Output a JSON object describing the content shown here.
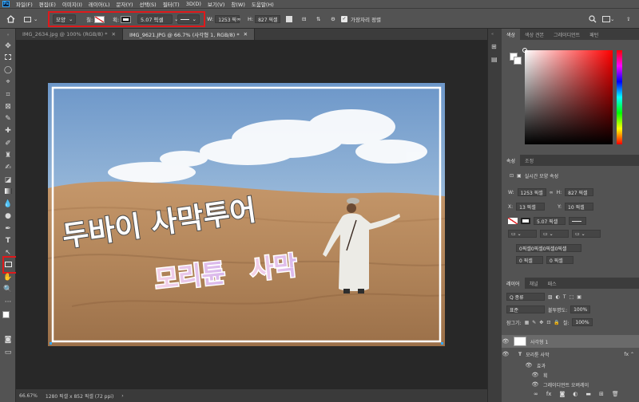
{
  "menu": [
    "파일(F)",
    "편집(E)",
    "이미지(I)",
    "레이어(L)",
    "문자(Y)",
    "선택(S)",
    "필터(T)",
    "3D(D)",
    "보기(V)",
    "창(W)",
    "도움말(H)"
  ],
  "options": {
    "mode": "모양",
    "fill_label": "칠:",
    "stroke_label": "획:",
    "stroke_width": "5.07 픽셀",
    "w_label": "W:",
    "w_value": "1253 픽",
    "h_label": "H:",
    "h_value": "827 픽셀",
    "align_edges": "가장자리 정렬"
  },
  "tabs": [
    "IMG_2634.jpg @ 100% (RGB/8) *",
    "IMG_9621.JPG @ 66.7% (사각형 1, RGB/8) *"
  ],
  "photo_text": {
    "line1": "두바이 사막투어",
    "line2_a": "모리튠",
    "line2_b": "사막"
  },
  "status": {
    "zoom": "66.67%",
    "size": "1280 픽셀 x 852 픽셀 (72 ppi)"
  },
  "color_panel": {
    "tabs": [
      "색상",
      "색상 견본",
      "그레이디언트",
      "패턴"
    ]
  },
  "props_panel": {
    "tabs": [
      "속성",
      "조정"
    ],
    "live_shape": "실시간 모양 속성",
    "w": "1253 픽셀",
    "h": "827 픽셀",
    "x": "13 픽셀",
    "y": "10 픽셀",
    "stroke": "5.07 픽셀",
    "corner_all": "0픽셀0픽셀0픽셀0픽셀",
    "c1": "0 픽셀",
    "c2": "0 픽셀",
    "c3": "0 픽셀",
    "c4": "0 픽셀"
  },
  "layers_panel": {
    "tabs": [
      "레이어",
      "채널",
      "패스"
    ],
    "kind": "Q 종류",
    "blend": "표준",
    "opacity_label": "불투명도:",
    "opacity": "100%",
    "lock_label": "잠그기:",
    "fill_label": "칠:",
    "fill": "100%",
    "layers": [
      {
        "name": "사각형 1",
        "type": "shape"
      },
      {
        "name": "모리튠 사막",
        "type": "text"
      },
      {
        "name": "효과",
        "type": "effect"
      },
      {
        "name": "획",
        "type": "effect-item"
      },
      {
        "name": "그레이디언트 오버레이",
        "type": "effect-item"
      }
    ]
  },
  "colors": {
    "highlight": "#e0191b",
    "accent": "#31a8ff"
  }
}
